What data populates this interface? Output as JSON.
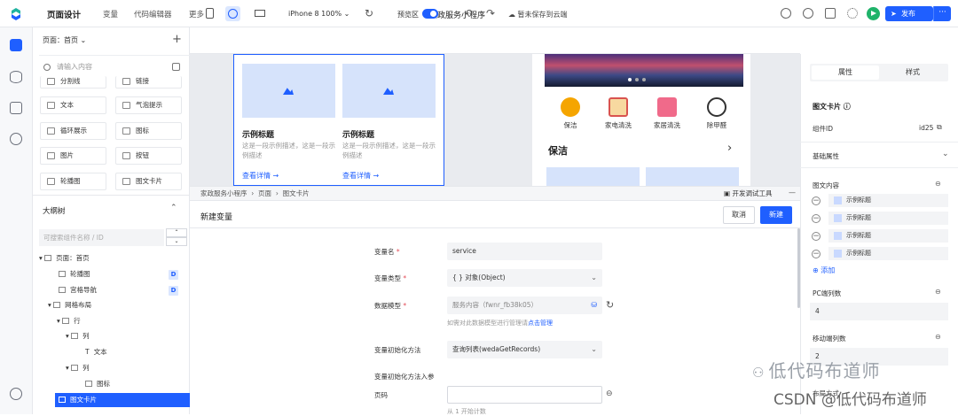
{
  "topbar": {
    "nav": [
      "页面设计",
      "变量",
      "代码编辑器",
      "更多"
    ],
    "app_title": "家政服务小程序",
    "save_status": "暂未保存到云端",
    "publish_label": "发布",
    "more_label": "···",
    "accent": "#1f5fff"
  },
  "left": {
    "page_selector": "页面：首页",
    "search_placeholder": "请输入内容",
    "components": [
      {
        "label": "分割线",
        "icon": "divider-icon"
      },
      {
        "label": "链接",
        "icon": "link-icon"
      },
      {
        "label": "文本",
        "icon": "text-icon"
      },
      {
        "label": "气泡提示",
        "icon": "tooltip-icon"
      },
      {
        "label": "循环展示",
        "icon": "loop-icon"
      },
      {
        "label": "图标",
        "icon": "icon-icon"
      },
      {
        "label": "图片",
        "icon": "image-icon"
      },
      {
        "label": "按钮",
        "icon": "button-icon"
      },
      {
        "label": "轮播图",
        "icon": "carousel-icon"
      },
      {
        "label": "图文卡片",
        "icon": "card-icon"
      }
    ],
    "outline_title": "大纲树",
    "tree_search_placeholder": "可搜索组件名称 / ID",
    "tree": [
      {
        "label": "页面：首页",
        "badge": ""
      },
      {
        "label": "轮播图",
        "badge": "D"
      },
      {
        "label": "宫格导航",
        "badge": "D"
      },
      {
        "label": "网格布局",
        "badge": ""
      },
      {
        "label": "行",
        "badge": ""
      },
      {
        "label": "列",
        "badge": ""
      },
      {
        "label": "文本",
        "badge": ""
      },
      {
        "label": "列",
        "badge": ""
      },
      {
        "label": "图标",
        "badge": ""
      },
      {
        "label": "图文卡片",
        "badge": ""
      }
    ]
  },
  "toolbar": {
    "device": "iPhone 8 100%",
    "preview_label": "预览区"
  },
  "canvas": {
    "cards": [
      {
        "title": "示例标题",
        "desc": "这是一段示例描述，这是一段示例描述",
        "link": "查看详情 →"
      },
      {
        "title": "示例标题",
        "desc": "这是一段示例描述，这是一段示例描述",
        "link": "查看详情 →"
      }
    ],
    "services": [
      "保洁",
      "家电清洗",
      "家居清洗",
      "除甲醛"
    ],
    "section_title": "保洁",
    "section_arrow": "›"
  },
  "debug": {
    "breadcrumb": [
      "家政服务小程序",
      "页面",
      "图文卡片"
    ],
    "devtools_label": "开发调试工具"
  },
  "newvar": {
    "title": "新建变量",
    "cancel": "取消",
    "create": "新建",
    "fields": {
      "name_label": "变量名",
      "name_value": "service",
      "type_label": "变量类型",
      "type_value": "{ }  对象(Object)",
      "model_label": "数据模型",
      "model_value": "服务内容（fwnr_fb38k05）",
      "manage_hint": "如需对此数据模型进行管理请",
      "manage_link": "点击管理",
      "init_label": "变量初始化方法",
      "init_value": "查询列表(wedaGetRecords)",
      "params_label": "变量初始化方法入参",
      "page_label": "页码",
      "page_hint": "从 1 开始计数"
    }
  },
  "right": {
    "tabs": [
      "属性",
      "样式"
    ],
    "component_title": "图文卡片",
    "component_id_label": "组件ID",
    "component_id_value": "id25",
    "basic_props": "基础属性",
    "content_label": "图文内容",
    "items": [
      "示例标题",
      "示例标题",
      "示例标题",
      "示例标题"
    ],
    "add_label": "添加",
    "pc_cols_label": "PC端列数",
    "pc_cols_value": "4",
    "mobile_cols_label": "移动端列数",
    "mobile_cols_value": "2",
    "layout_label": "布局方式"
  },
  "watermark": {
    "line1": "低代码布道师",
    "line2": "CSDN @低代码布道师"
  }
}
